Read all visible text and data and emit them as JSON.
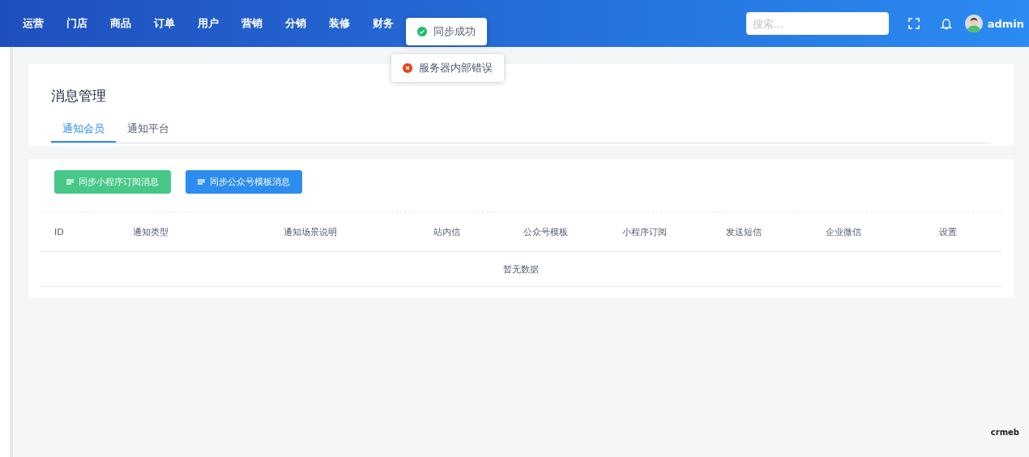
{
  "nav": {
    "items": [
      {
        "label": "运营"
      },
      {
        "label": "门店"
      },
      {
        "label": "商品"
      },
      {
        "label": "订单"
      },
      {
        "label": "用户"
      },
      {
        "label": "营销"
      },
      {
        "label": "分销"
      },
      {
        "label": "装修"
      },
      {
        "label": "财务"
      }
    ],
    "search": {
      "placeholder": "搜索..."
    },
    "user": "admin"
  },
  "toasts": [
    {
      "kind": "success",
      "text": "同步成功"
    },
    {
      "kind": "error",
      "text": "服务器内部错误"
    }
  ],
  "page": {
    "title": "消息管理",
    "tabs": [
      {
        "label": "通知会员",
        "selected": true
      },
      {
        "label": "通知平台",
        "selected": false
      }
    ]
  },
  "buttons": [
    {
      "label": "同步小程序订阅消息",
      "color": "#47c888"
    },
    {
      "label": "同步公众号模板消息",
      "color": "#2d8cf0"
    }
  ],
  "table": {
    "columns": [
      "ID",
      "通知类型",
      "通知场景说明",
      "站内信",
      "公众号模板",
      "小程序订阅",
      "发送短信",
      "企业微信",
      "设置"
    ],
    "empty": "暂无数据"
  },
  "logo": "crmeb"
}
